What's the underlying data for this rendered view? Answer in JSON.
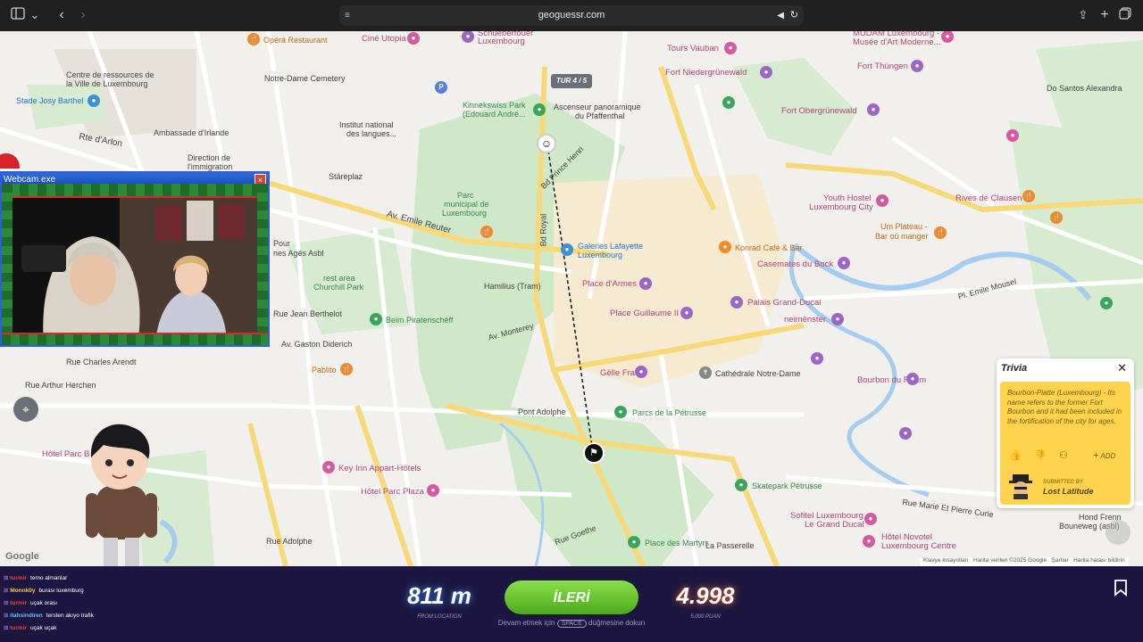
{
  "browser": {
    "url": "geoguessr.com"
  },
  "map": {
    "round_badge": "TUR 4 / 5",
    "google_logo": "Google",
    "footer": {
      "shortcuts": "Klavye kısayolları",
      "attribution": "Harita verileri ©2025 Google",
      "terms": "Şartlar",
      "report": "Harita hatası bildirin"
    },
    "labels": [
      {
        "text": "Opéra Restaurant",
        "cls": "orange"
      },
      {
        "text": "Ciné Utopia",
        "cls": "poi"
      },
      {
        "text": "Schueberfouer",
        "cls": "poi"
      },
      {
        "text": "Luxembourg",
        "cls": "poi"
      },
      {
        "text": "Tours Vauban",
        "cls": "poi"
      },
      {
        "text": "Fort Niedergrünewald",
        "cls": "poi"
      },
      {
        "text": "MUDAM Luxembourg -",
        "cls": "poi"
      },
      {
        "text": "Musée d'Art Moderne...",
        "cls": "poi"
      },
      {
        "text": "Centre de ressources de",
        "cls": "dark"
      },
      {
        "text": "la Ville de Luxembourg",
        "cls": "dark"
      },
      {
        "text": "Notre-Dame Cemetery",
        "cls": "dark"
      },
      {
        "text": "Fort Thüngen",
        "cls": "poi"
      },
      {
        "text": "Do Santos Alexandra",
        "cls": "dark"
      },
      {
        "text": "Stade Josy Barthel",
        "cls": "blue"
      },
      {
        "text": "Kinnekswiss Park",
        "cls": "green"
      },
      {
        "text": "(Edouard André...",
        "cls": "green"
      },
      {
        "text": "Ascenseur panoramique",
        "cls": "dark"
      },
      {
        "text": "du Pfaffenthal",
        "cls": "dark"
      },
      {
        "text": "Fort Obergrünewald",
        "cls": "poi"
      },
      {
        "text": "Ambassade d'Irlande",
        "cls": "dark"
      },
      {
        "text": "Institut national",
        "cls": "dark"
      },
      {
        "text": "des langues...",
        "cls": "dark"
      },
      {
        "text": "Direction de",
        "cls": "dark"
      },
      {
        "text": "l'immigration",
        "cls": "dark"
      },
      {
        "text": "Rte d'Arlon",
        "cls": "dark"
      },
      {
        "text": "Stäreplaz",
        "cls": "dark"
      },
      {
        "text": "Bd Prince Henri",
        "cls": "dark"
      },
      {
        "text": "Youth Hostel",
        "cls": "poi"
      },
      {
        "text": "Luxembourg City",
        "cls": "poi"
      },
      {
        "text": "Rives de Clausen",
        "cls": "poi"
      },
      {
        "text": "Parc",
        "cls": "green"
      },
      {
        "text": "municipal de",
        "cls": "green"
      },
      {
        "text": "Luxembourg",
        "cls": "green"
      },
      {
        "text": "Av. Emile Reuter",
        "cls": "dark"
      },
      {
        "text": "Galeries Lafayette",
        "cls": "blue"
      },
      {
        "text": "Luxembourg",
        "cls": "blue"
      },
      {
        "text": "Um Plateau -",
        "cls": "orange"
      },
      {
        "text": "Bar où manger",
        "cls": "orange"
      },
      {
        "text": "Konrad Café & Bar",
        "cls": "orange"
      },
      {
        "text": "Pour",
        "cls": "dark"
      },
      {
        "text": "nes Agés Asbl",
        "cls": "dark"
      },
      {
        "text": "Casemates du Bock",
        "cls": "poi"
      },
      {
        "text": "rest area",
        "cls": "green"
      },
      {
        "text": "Churchill Park",
        "cls": "green"
      },
      {
        "text": "Hamilius (Tram)",
        "cls": "dark"
      },
      {
        "text": "Place d'Armes",
        "cls": "poi"
      },
      {
        "text": "Palais Grand-Ducal",
        "cls": "poi"
      },
      {
        "text": "Pl. Emile Mousel",
        "cls": "dark"
      },
      {
        "text": "Rue Jean Berthelot",
        "cls": "dark"
      },
      {
        "text": "Place Guillaume II",
        "cls": "poi"
      },
      {
        "text": "neimënster",
        "cls": "poi"
      },
      {
        "text": "Beim Piratenschëff",
        "cls": "green"
      },
      {
        "text": "Av. Monterey",
        "cls": "dark"
      },
      {
        "text": "Av. Gaston Diderich",
        "cls": "dark"
      },
      {
        "text": "Rue Charles Arendt",
        "cls": "dark"
      },
      {
        "text": "Pablito",
        "cls": "orange"
      },
      {
        "text": "Gëlle Fra",
        "cls": "poi"
      },
      {
        "text": "Cathédrale Notre-Dame",
        "cls": "dark"
      },
      {
        "text": "Bourbon du Rham",
        "cls": "poi"
      },
      {
        "text": "Rue Arthur Herchen",
        "cls": "dark"
      },
      {
        "text": "Pont Adolphe",
        "cls": "dark"
      },
      {
        "text": "Parcs de la Pétrusse",
        "cls": "green"
      },
      {
        "text": "Hôtel Parc B",
        "cls": "poi"
      },
      {
        "text": "Key Inn Appart-Hôtels",
        "cls": "poi"
      },
      {
        "text": "Hôtel Parc Plaza",
        "cls": "poi"
      },
      {
        "text": "Skatepark Pétrusse",
        "cls": "green"
      },
      {
        "text": "Sofitel Luxembourg",
        "cls": "poi"
      },
      {
        "text": "Le Grand Ducal",
        "cls": "poi"
      },
      {
        "text": "Rue Marie Et Pierre Curie",
        "cls": "dark"
      },
      {
        "text": "Hond Frenn",
        "cls": "dark"
      },
      {
        "text": "Bouneweg (asbl)",
        "cls": "dark"
      },
      {
        "text": "villon",
        "cls": "orange"
      },
      {
        "text": "Rue Adolphe",
        "cls": "dark"
      },
      {
        "text": "Rue Goethe",
        "cls": "dark"
      },
      {
        "text": "La Passerelle",
        "cls": "dark"
      },
      {
        "text": "Place des Martyrs",
        "cls": "green"
      },
      {
        "text": "Hôtel Novotel",
        "cls": "poi"
      },
      {
        "text": "Luxembourg Centre",
        "cls": "poi"
      },
      {
        "text": "Bd Royal",
        "cls": "dark"
      }
    ]
  },
  "webcam": {
    "title": "Webcam.exe",
    "close": "×"
  },
  "trivia": {
    "title": "Trivia",
    "close": "✕",
    "text": "Bourbon-Platte (Luxembourg) - Its name refers to the former Fort Bourbon and it had been included in the fortification of the city for ages.",
    "add_label": "ADD",
    "submitted_by": "SUBMITTED BY",
    "author": "Lost Latitude"
  },
  "chat": [
    {
      "user": "turmir",
      "text": "temo almanlar",
      "color": "#e0463e"
    },
    {
      "user": "Monnk0y",
      "text": "burası luxemburg",
      "color": "#f2c94c"
    },
    {
      "user": "turmir",
      "text": "uçak orası",
      "color": "#e0463e"
    },
    {
      "user": "ilahsindiren",
      "text": "tersten akıyo trafik",
      "color": "#5bc8f5"
    },
    {
      "user": "turmir",
      "text": "uçak uçak",
      "color": "#e0463e"
    }
  ],
  "result": {
    "distance": "811 m",
    "distance_label": "FROM LOCATION",
    "next_button": "İLERİ",
    "hint_prefix": "Devam etmek için",
    "hint_key": "SPACE",
    "hint_suffix": "düğmesine dokun",
    "score": "4.998",
    "score_label": "5.000 PUAN"
  }
}
